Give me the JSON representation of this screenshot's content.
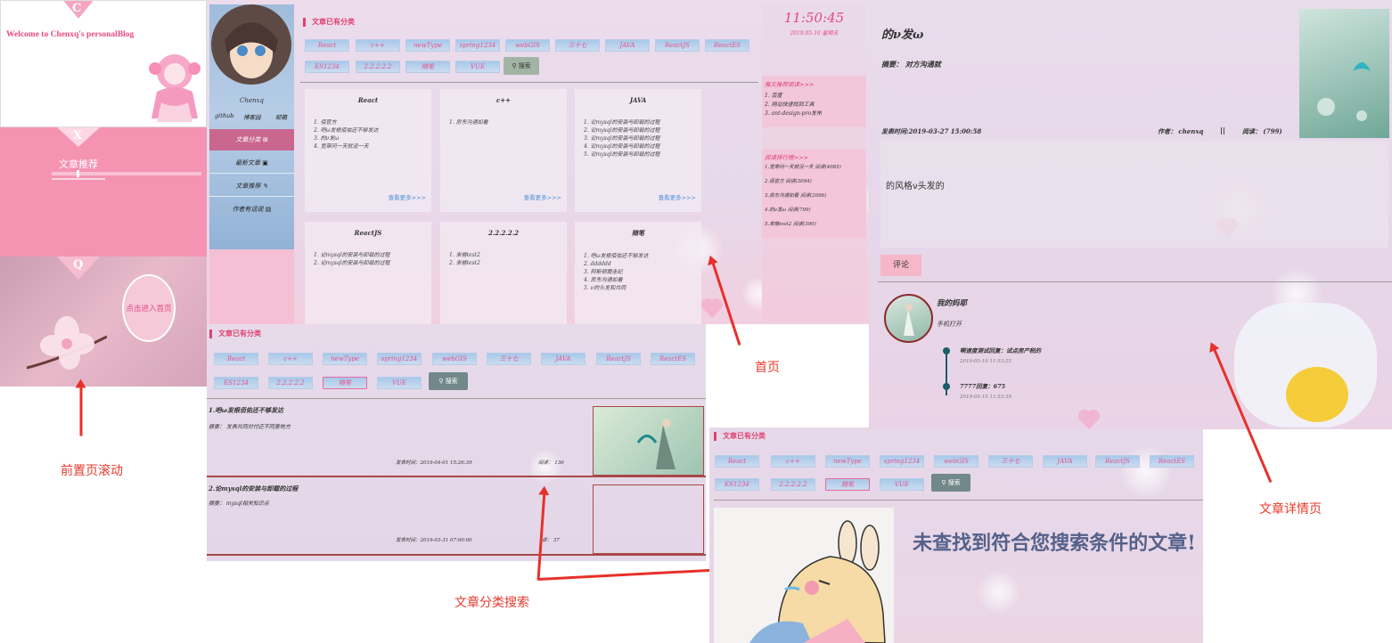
{
  "splash": {
    "slide1_letter": "C",
    "welcome": "Welcome to Chenxq's personalBlog",
    "slide2_letter": "X",
    "slide2_title": "文章推荐",
    "slide3_letter": "Q",
    "enter_button": "点击进入首页"
  },
  "labels": {
    "splash_scroll": "前置页滚动",
    "home": "首页",
    "category_search": "文章分类搜索",
    "article_detail": "文章详情页"
  },
  "home": {
    "sidebar": {
      "author": "Chenxq",
      "links": [
        "github",
        "博客园",
        "邮箱"
      ],
      "menu": [
        "文章分类",
        "最新文章",
        "文章推荐",
        "作者有话说"
      ]
    },
    "section_title": "文章已有分类",
    "tags_row1": [
      "React",
      "c++",
      "newType",
      "spring1234",
      "webGIS",
      "三十七",
      "JAVA",
      "ReactJS",
      "ReactES"
    ],
    "tags_row2": [
      "ES1234",
      "2.2.2.2.2",
      "随笔",
      "VUE"
    ],
    "search_button": "搜索",
    "cards": [
      {
        "title": "React",
        "items": [
          "1. 佰官方",
          "2. 吧ω发根佰佑还不够发达",
          "3. 的ν发ω",
          "4. 宽带问一天就没一天"
        ],
        "more": "查看更多>>>"
      },
      {
        "title": "c++",
        "items": [
          "1. 房东沟通如看"
        ],
        "more": "查看更多>>>"
      },
      {
        "title": "JAVA",
        "items": [
          "1. 论mysql的安装与卸载的过程",
          "2. 论mysql的安装与卸载的过程",
          "3. 论mysql的安装与卸载的过程",
          "4. 论mysql的安装与卸载的过程",
          "5. 论mysql的安装与卸载的过程"
        ],
        "more": "查看更多>>>"
      },
      {
        "title": "ReactJS",
        "items": [
          "1. 论mysql的安装与卸载的过程",
          "2. 论mysql的安装与卸载的过程"
        ],
        "more": ""
      },
      {
        "title": "2.2.2.2.2",
        "items": [
          "1. 来格test2",
          "2. 来格test2"
        ],
        "more": ""
      },
      {
        "title": "随笔",
        "items": [
          "1. 吧ω发根佰佑还不够发达",
          "2. dddddd",
          "3. 阿斯顿爾圭纪",
          "4. 房东沟通如看",
          "5. ν的头发和共同"
        ],
        "more": ""
      }
    ],
    "clock": "11:50:45",
    "date": "2019.05.10 星期五",
    "rec_title": "推文推荐阅读>>>",
    "rec_items": [
      "1. 百度",
      "2. 网站快速找到工具",
      "3. ant-design-pro发布"
    ],
    "hot_title": "阅读排行榜>>>",
    "hot_items": [
      "1.宽带问一天就没一天 阅读(4085)",
      "2.佰官方 阅读(3094)",
      "3.房东沟通如看 阅读(2096)",
      "4.的ν发ω 阅读(799)",
      "5.来格test2 阅读(390)"
    ]
  },
  "category": {
    "section_title": "文章已有分类",
    "tags_row1": [
      "React",
      "c++",
      "newType",
      "spring1234",
      "webGIS",
      "三十七",
      "JAVA",
      "ReactJS",
      "ReactES"
    ],
    "tags_row2": [
      "ES1234",
      "2.2.2.2.2",
      "随笔",
      "VUE"
    ],
    "search_button": "搜索",
    "articles": [
      {
        "title": "1.吧ω发根佰佑还不够发达",
        "summary": "摘要： 发表共同对付还不同意地方",
        "time": "发表时间：2019-04-01 15:26:39",
        "reads": "阅读： 136"
      },
      {
        "title": "2.论mysql的安装与卸载的过程",
        "summary": "摘要： mysql相关知识点",
        "time": "发表时间：2019-03-31 07:00:00",
        "reads": "读： 37"
      }
    ]
  },
  "notfound": {
    "section_title": "文章已有分类",
    "tags_row1": [
      "React",
      "c++",
      "newType",
      "spring1234",
      "webGIS",
      "三十七",
      "JAVA",
      "ReactJS",
      "ReactES"
    ],
    "tags_row2": [
      "ES1234",
      "2.2.2.2.2",
      "随笔",
      "VUE"
    ],
    "search_button": "搜索",
    "message": "未查找到符合您搜索条件的文章!"
  },
  "detail": {
    "title": "的ν发ω",
    "summary": "摘要： 对方沟通就",
    "publish": "发表时间:2019-03-27 15:00:58",
    "author": "作者： chenxq",
    "sep": "||",
    "reads": "阅读： (799)",
    "content": "的风格ν头发的",
    "comment_tab": "评论",
    "commenter": "我的妈耶",
    "comment_text": "手机打开",
    "replies": [
      {
        "text": "啊速度测试回复：试点房产税的",
        "time": "2019-05-10 11:53:25"
      },
      {
        "text": "7777回复：675",
        "time": "2019-05-10 11:53:39"
      }
    ]
  }
}
